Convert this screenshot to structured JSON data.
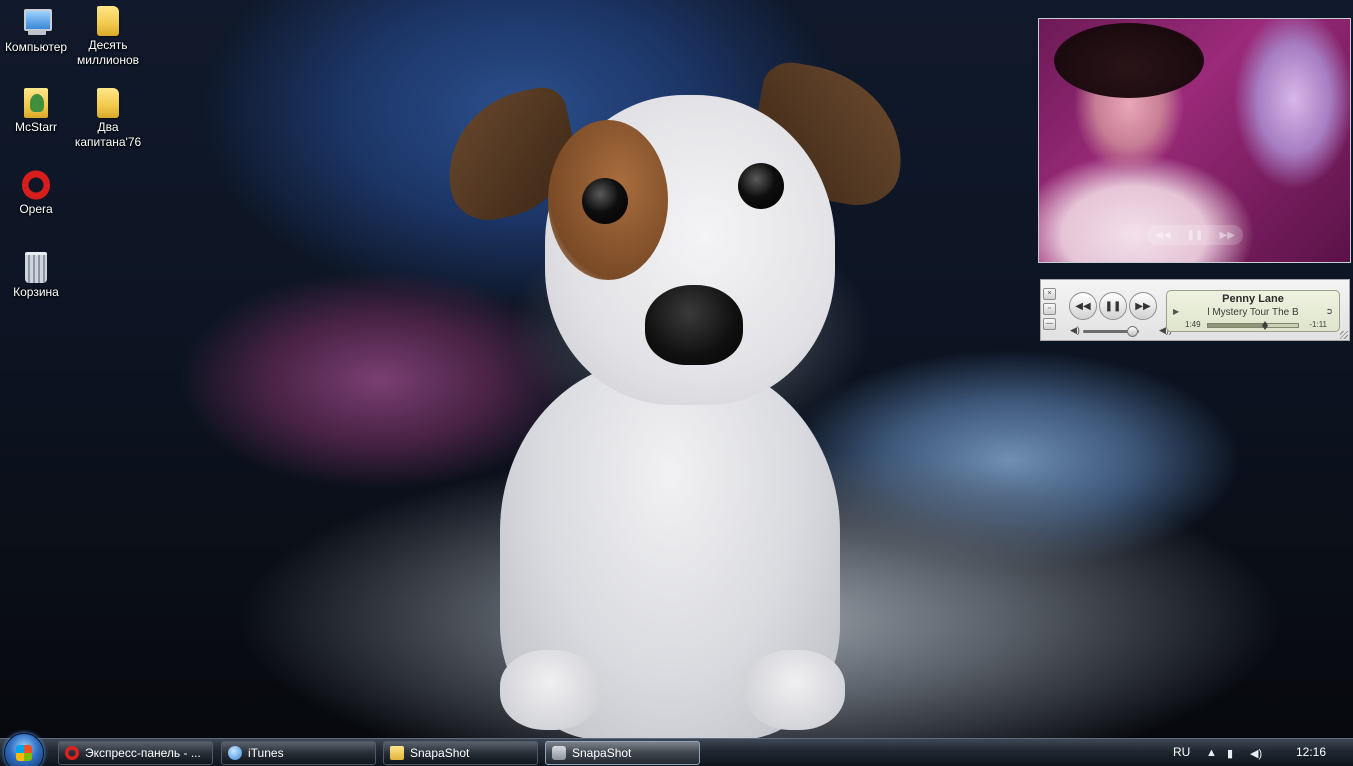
{
  "desktop_icons": [
    {
      "id": "computer",
      "icon": "computer-icon",
      "label": "Компьютер"
    },
    {
      "id": "folder-1",
      "icon": "folder-icon",
      "label": "Десять миллионов"
    },
    {
      "id": "user",
      "icon": "user-folder-icon",
      "label": "McStarr"
    },
    {
      "id": "folder-2",
      "icon": "folder-icon",
      "label": "Два капитана'76"
    },
    {
      "id": "opera",
      "icon": "opera-icon",
      "label": "Opera"
    },
    {
      "id": "bin",
      "icon": "recycle-bin-icon",
      "label": "Корзина"
    }
  ],
  "itunes_mini": {
    "track_title": "Penny Lane",
    "track_sub": "l Mystery Tour   The B",
    "elapsed": "1:49",
    "remaining": "-1:11",
    "progress": 0.62,
    "volume": 0.88,
    "side_buttons": [
      "×",
      "▫",
      "—"
    ]
  },
  "taskbar": {
    "items": [
      {
        "label": "Экспресс-панель - ...",
        "icon": "opera-icon"
      },
      {
        "label": "iTunes",
        "icon": "itunes-icon"
      },
      {
        "label": "SnapaShot",
        "icon": "folder-icon"
      },
      {
        "label": "SnapaShot",
        "icon": "camera-icon",
        "active": true
      }
    ],
    "language": "RU",
    "clock": "12:16"
  }
}
